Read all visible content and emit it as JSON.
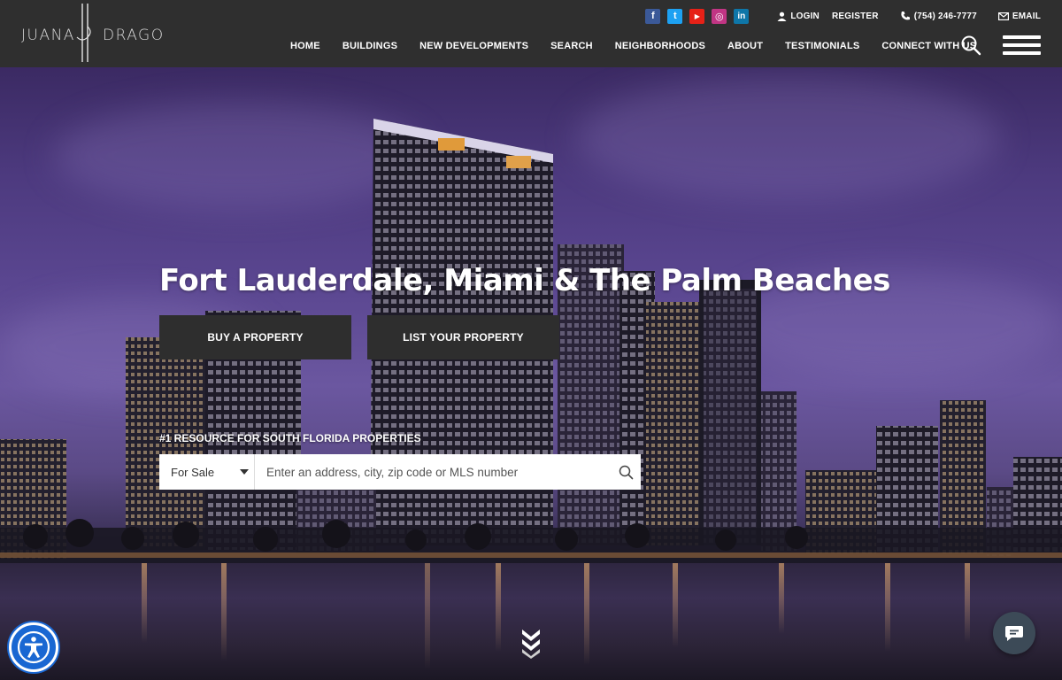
{
  "header": {
    "logo": {
      "left": "JUANA",
      "right": "DRAGO"
    },
    "social": [
      {
        "name": "facebook",
        "glyph": "f",
        "color": "#3b5998"
      },
      {
        "name": "twitter",
        "glyph": "t",
        "color": "#1da1f2"
      },
      {
        "name": "youtube",
        "glyph": "▶",
        "color": "#e62117"
      },
      {
        "name": "instagram",
        "glyph": "◎",
        "color": "#c13584"
      },
      {
        "name": "linkedin",
        "glyph": "in",
        "color": "#0e76a8"
      }
    ],
    "login": "LOGIN",
    "register": "REGISTER",
    "phone": "(754) 246-7777",
    "email": "EMAIL",
    "nav": [
      "HOME",
      "BUILDINGS",
      "NEW DEVELOPMENTS",
      "SEARCH",
      "NEIGHBORHOODS",
      "ABOUT",
      "TESTIMONIALS",
      "CONNECT WITH US"
    ]
  },
  "hero": {
    "headline": "Fort Lauderdale, Miami & The Palm Beaches",
    "buy_label": "BUY A PROPERTY",
    "list_label": "LIST YOUR PROPERTY",
    "resource_label": "#1 RESOURCE FOR SOUTH FLORIDA PROPERTIES",
    "search": {
      "type_selected": "For Sale",
      "placeholder": "Enter an address, city, zip code or MLS number"
    }
  },
  "colors": {
    "accessibility": "#1967d2",
    "chat": "#3c4a57",
    "header": "#2f2f2f"
  }
}
